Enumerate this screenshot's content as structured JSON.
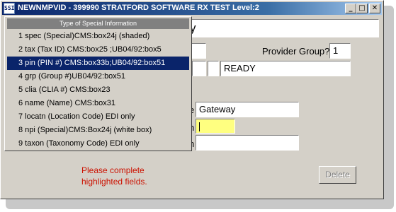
{
  "window": {
    "title": "NEWNMPVID - 399990 STRATFORD SOFTWARE RX TEST Level:2",
    "icon_text": "SSI",
    "controls": {
      "minimize": "_",
      "maximize": "□",
      "close": "✕"
    }
  },
  "form": {
    "heading_visible_fragment": "y",
    "provider_group_label": "Provider Group?",
    "provider_group_value": "1",
    "status_value": "READY",
    "label_fragment_1": "e",
    "label_fragment_2": "n",
    "label_fragment_3": "n",
    "gateway_value": "Gateway",
    "required_field_value": "",
    "third_field_value": ""
  },
  "message": {
    "line1": "Please complete",
    "line2": "highlighted fields."
  },
  "buttons": {
    "delete": "Delete"
  },
  "colors": {
    "required_highlight": "#ffff80",
    "message": "#cc1100",
    "selection": "#0a246a"
  },
  "dropdown": {
    "header": "Type of Special Information",
    "selected_index": 2,
    "items": [
      "1 spec   (Special)CMS:box24j (shaded)",
      "2 tax    (Tax ID) CMS:box25 ;UB04/92:box5",
      "3 pin    (PIN #)  CMS:box33b;UB04/92:box51",
      "4 grp    (Group #)UB04/92:box51",
      "5 clia   (CLIA #) CMS:box23",
      "6 name   (Name)   CMS:box31",
      "7 locatn (Location Code)  EDI only",
      "8 npi    (Special)CMS:Box24j (white box)",
      "9 taxon  (Taxonomy Code)  EDI only"
    ]
  }
}
